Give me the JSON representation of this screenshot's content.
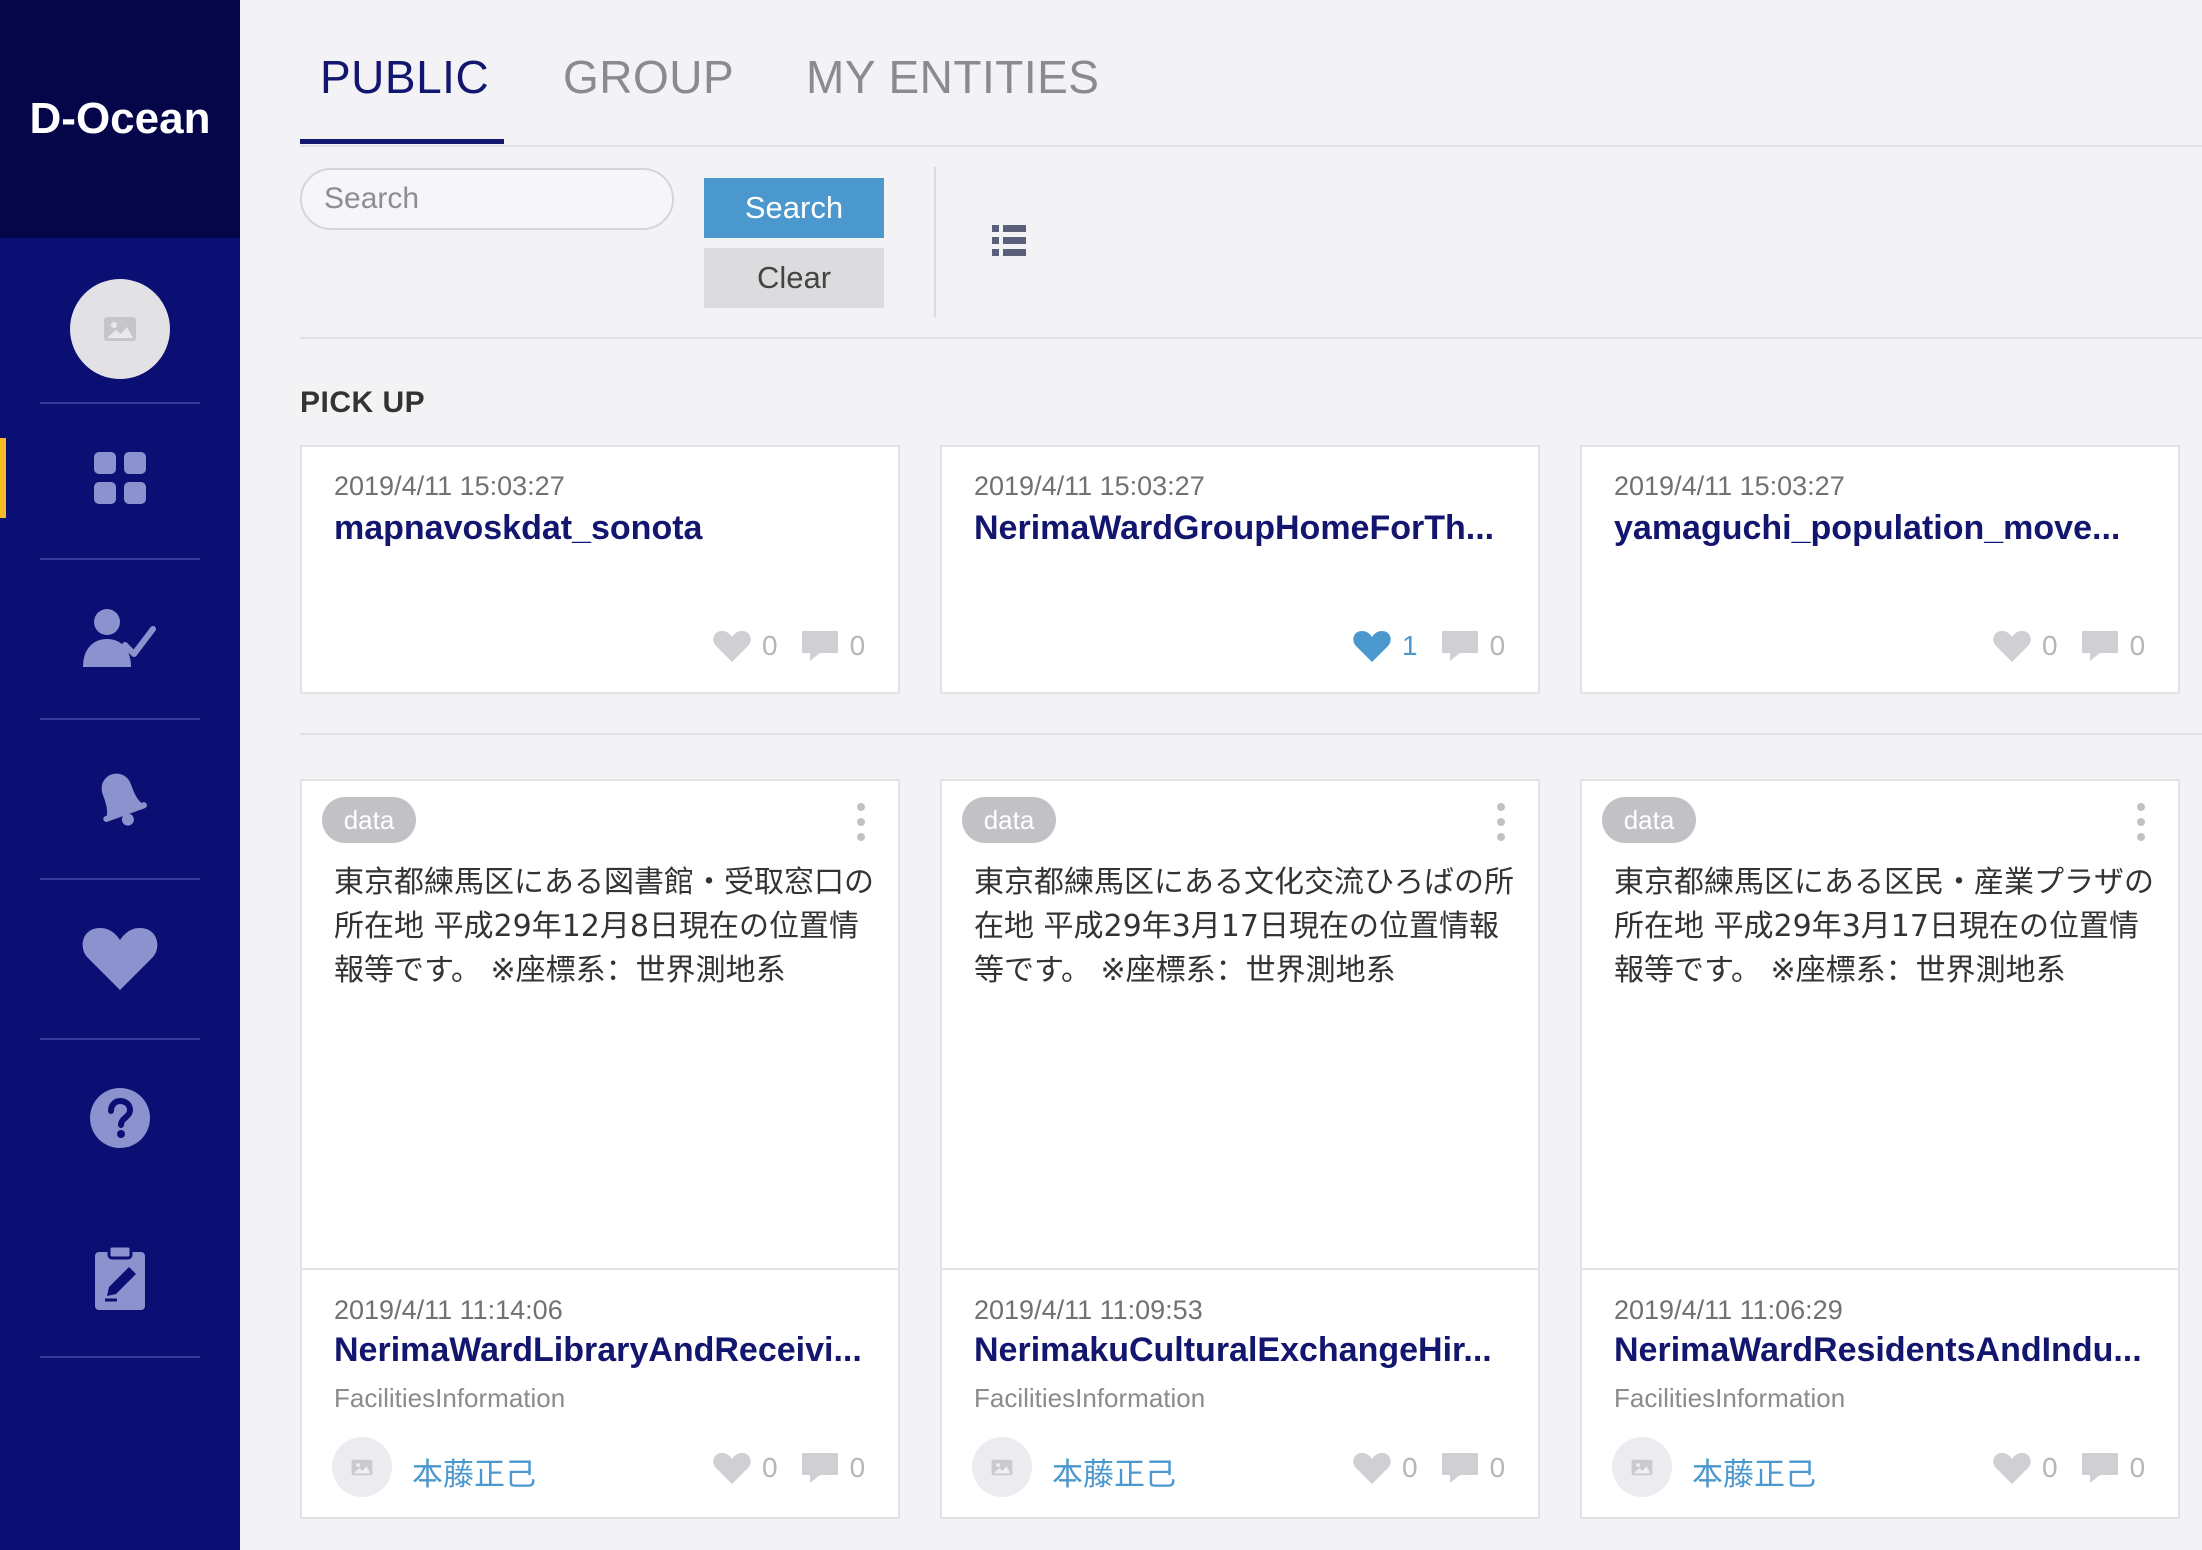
{
  "app": {
    "brand": "D-Ocean"
  },
  "sidebar": {
    "items": [
      {
        "icon": "dashboard-icon"
      },
      {
        "icon": "user-check-icon"
      },
      {
        "icon": "bell-icon"
      },
      {
        "icon": "heart-icon"
      },
      {
        "icon": "help-icon"
      },
      {
        "icon": "clipboard-edit-icon"
      }
    ],
    "accent": "#f4bb27",
    "background": "#0b0f73"
  },
  "tabs": [
    {
      "label": "PUBLIC",
      "active": true
    },
    {
      "label": "GROUP",
      "active": false
    },
    {
      "label": "MY ENTITIES",
      "active": false
    }
  ],
  "search": {
    "placeholder": "Search",
    "value": "",
    "search_label": "Search",
    "clear_label": "Clear"
  },
  "pickup": {
    "title": "PICK UP",
    "cards": [
      {
        "date": "2019/4/11 15:03:27",
        "title": "mapnavoskdat_sonota",
        "likes": "0",
        "comments": "0",
        "liked": false
      },
      {
        "date": "2019/4/11 15:03:27",
        "title": "NerimaWardGroupHomeForTh...",
        "likes": "1",
        "comments": "0",
        "liked": true
      },
      {
        "date": "2019/4/11 15:03:27",
        "title": "yamaguchi_population_move...",
        "likes": "0",
        "comments": "0",
        "liked": false
      }
    ]
  },
  "entities": [
    {
      "badge": "data",
      "description": "東京都練馬区にある図書館・受取窓口の所在地 平成29年12月8日現在の位置情報等です。 ※座標系：世界測地系",
      "date": "2019/4/11 11:14:06",
      "title": "NerimaWardLibraryAndReceivi...",
      "category": "FacilitiesInformation",
      "author": "本藤正己",
      "likes": "0",
      "comments": "0"
    },
    {
      "badge": "data",
      "description": "東京都練馬区にある文化交流ひろばの所在地 平成29年3月17日現在の位置情報等です。 ※座標系：世界測地系",
      "date": "2019/4/11 11:09:53",
      "title": "NerimakuCulturalExchangeHir...",
      "category": "FacilitiesInformation",
      "author": "本藤正己",
      "likes": "0",
      "comments": "0"
    },
    {
      "badge": "data",
      "description": "東京都練馬区にある区民・産業プラザの所在地 平成29年3月17日現在の位置情報等です。 ※座標系：世界測地系",
      "date": "2019/4/11 11:06:29",
      "title": "NerimaWardResidentsAndIndu...",
      "category": "FacilitiesInformation",
      "author": "本藤正己",
      "likes": "0",
      "comments": "0"
    }
  ],
  "colors": {
    "primary": "#12166e",
    "link": "#4a98cd",
    "liked": "#4a98cd"
  }
}
